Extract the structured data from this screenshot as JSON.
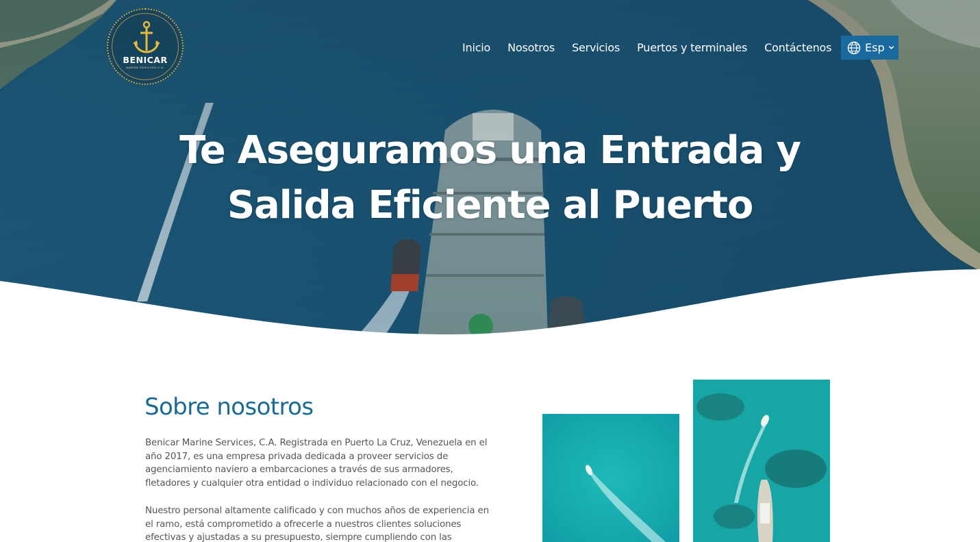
{
  "brand": {
    "name": "BENICAR",
    "subtitle": "MARINE SERVICES C.A.",
    "accent_gold": "#c9a74a"
  },
  "nav": {
    "items": [
      {
        "label": "Inicio"
      },
      {
        "label": "Nosotros"
      },
      {
        "label": "Servicios"
      },
      {
        "label": "Puertos y terminales"
      },
      {
        "label": "Contáctenos"
      }
    ],
    "language": {
      "label": "Esp",
      "icon": "globe-icon",
      "dropdown_icon": "chevron-down-icon"
    }
  },
  "hero": {
    "title_line1": "Te Aseguramos una Entrada y",
    "title_line2": "Salida Eficiente al Puerto",
    "image": "aerial-ship-harbor-photo"
  },
  "about": {
    "heading": "Sobre nosotros",
    "paragraph1": "Benicar Marine Services, C.A. Registrada en Puerto La Cruz, Venezuela en el año 2017, es una empresa privada dedicada a proveer servicios de agenciamiento naviero a embarcaciones a través de sus armadores, fletadores y cualquier otra entidad o individuo relacionado con el negocio.",
    "paragraph2": "Nuestro personal altamente calificado y con muchos años de experiencia en el ramo, está comprometido a ofrecerle a nuestros clientes soluciones efectivas y ajustadas a su presupuesto, siempre cumpliendo con las",
    "photos": [
      "aerial-boat-turquoise-water-photo",
      "aerial-boats-reef-photo"
    ]
  },
  "colors": {
    "heading_blue": "#1a6a96",
    "lang_button": "#1a6aa0",
    "body_text": "#555555"
  }
}
